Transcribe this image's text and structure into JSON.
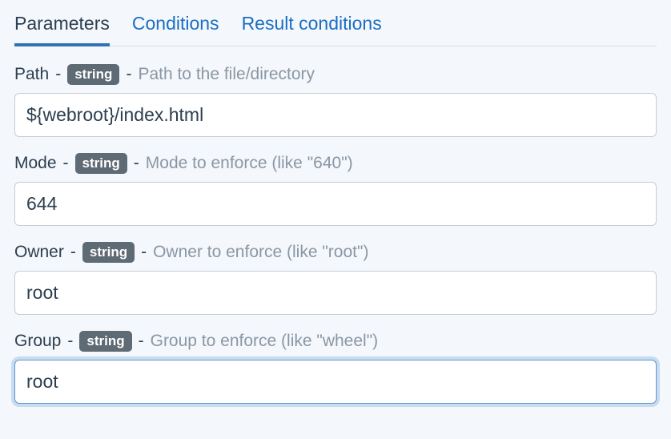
{
  "tabs": {
    "parameters": "Parameters",
    "conditions": "Conditions",
    "result_conditions": "Result conditions"
  },
  "fields": {
    "path": {
      "label": "Path",
      "type": "string",
      "description": "Path to the file/directory",
      "value": "${webroot}/index.html"
    },
    "mode": {
      "label": "Mode",
      "type": "string",
      "description": "Mode to enforce (like \"640\")",
      "value": "644"
    },
    "owner": {
      "label": "Owner",
      "type": "string",
      "description": "Owner to enforce (like \"root\")",
      "value": "root"
    },
    "group": {
      "label": "Group",
      "type": "string",
      "description": "Group to enforce (like \"wheel\")",
      "value": "root"
    }
  }
}
